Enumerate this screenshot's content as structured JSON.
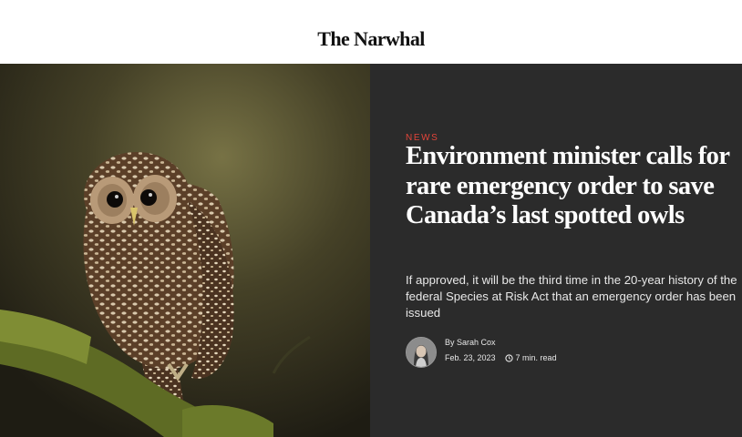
{
  "site": {
    "logo": "The Narwhal"
  },
  "hero_image": {
    "icon": "spotted-owl-photo"
  },
  "article": {
    "kicker": "NEWS",
    "headline": "Environment minister calls for rare emergency order to save Canada’s last spotted owls",
    "dek": "If approved, it will be the third time in the 20-year history of the federal Species at Risk Act that an emergency order has been issued",
    "byline": "By Sarah Cox",
    "date": "Feb. 23, 2023",
    "read_time": "7 min. read"
  },
  "colors": {
    "kicker": "#e2453a",
    "panel_bg": "#2b2b2b",
    "text": "#ffffff"
  }
}
